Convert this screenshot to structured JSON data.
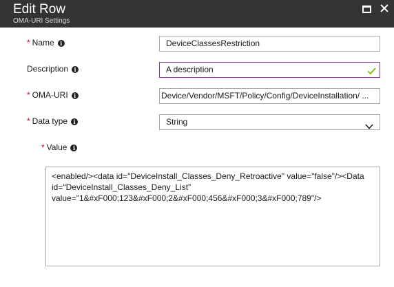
{
  "header": {
    "title": "Edit Row",
    "subtitle": "OMA-URI Settings"
  },
  "form": {
    "name": {
      "label": "Name",
      "required_mark": "*",
      "value": "DeviceClassesRestriction"
    },
    "description": {
      "label": "Description",
      "value": "A description"
    },
    "oma_uri": {
      "label": "OMA-URI",
      "required_mark": "*",
      "value": "Device/Vendor/MSFT/Policy/Config/DeviceInstallation/ ..."
    },
    "data_type": {
      "label": "Data type",
      "required_mark": "*",
      "value": "String"
    },
    "value": {
      "label": "Value",
      "required_mark": "*",
      "text": "<enabled/><data id=\"DeviceInstall_Classes_Deny_Retroactive\" value=\"false\"/><Data id=\"DeviceInstall_Classes_Deny_List\" value=\"1&#xF000;123&#xF000;2&#xF000;456&#xF000;3&#xF000;789\"/>"
    }
  },
  "info_glyph": "i",
  "colors": {
    "titlebar": "#333333",
    "required": "#d0021b",
    "valid_check": "#7fba00",
    "valid_border": "#7a3f8f"
  }
}
